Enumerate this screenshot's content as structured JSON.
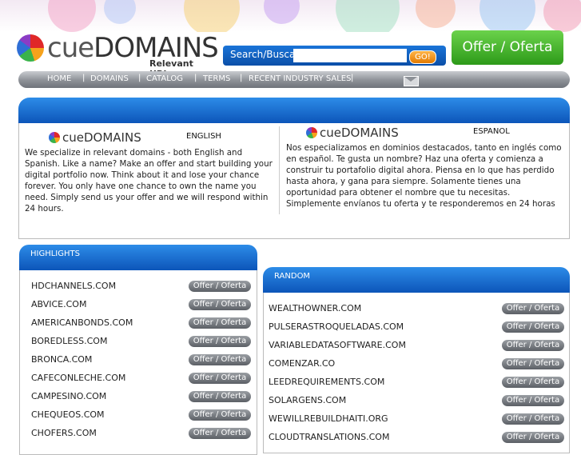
{
  "header": {
    "logo_text_cue": "cue",
    "logo_text_domains": "DOMAINS",
    "logo_tagline": "Relevant URLs",
    "search_label": "Search/Buscar",
    "search_value": "",
    "go_label": "GO!",
    "offer_button": "Offer / Oferta"
  },
  "nav": {
    "items": [
      "HOME",
      "DOMAINS",
      "CATALOG",
      "TERMS",
      "RECENT INDUSTRY SALES"
    ],
    "separator": "|",
    "mail_icon": "envelope-icon"
  },
  "intro": {
    "english": {
      "logo_cue": "cue",
      "logo_domains": "DOMAINS",
      "label": "ENGLISH",
      "text": "We specialize in relevant domains - both English and Spanish. Like a name? Make an offer and start building your digital portfolio now. Think about it and lose your chance forever. You only have one chance to own the name you need. Simply send us your offer and we will respond within 24 hours."
    },
    "spanish": {
      "logo_cue": "cue",
      "logo_domains": "DOMAINS",
      "label": "ESPANOL",
      "text": "Nos especializamos en dominios destacados, tanto en inglés como en español. Te gusta un nombre? Haz una oferta y comienza a construir tu portafolio digital ahora. Piensa en lo que has perdido hasta ahora, y gana para siempre. Solamente tienes una oportunidad para obtener el nombre que tu necesitas. Simplemente envíanos tu oferta y te responderemos en 24 horas"
    }
  },
  "highlights": {
    "title": "HIGHLIGHTS",
    "offer_label": "Offer / Oferta",
    "items": [
      "HDCHANNELS.COM",
      "ABVICE.COM",
      "AMERICANBONDS.COM",
      "BOREDLESS.COM",
      "BRONCA.COM",
      "CAFECONLECHE.COM",
      "CAMPESINO.COM",
      "CHEQUEOS.COM",
      "CHOFERS.COM"
    ]
  },
  "random": {
    "title": "RANDOM",
    "offer_label": "Offer / Oferta",
    "items": [
      "WEALTHOWNER.COM",
      "PULSERASTROQUELADAS.COM",
      "VARIABLEDATASOFTWARE.COM",
      "COMENZAR.CO",
      "LEEDREQUIREMENTS.COM",
      "SOLARGENS.COM",
      "WEWILLREBUILDHAITI.ORG",
      "CLOUDTRANSLATIONS.COM"
    ]
  }
}
